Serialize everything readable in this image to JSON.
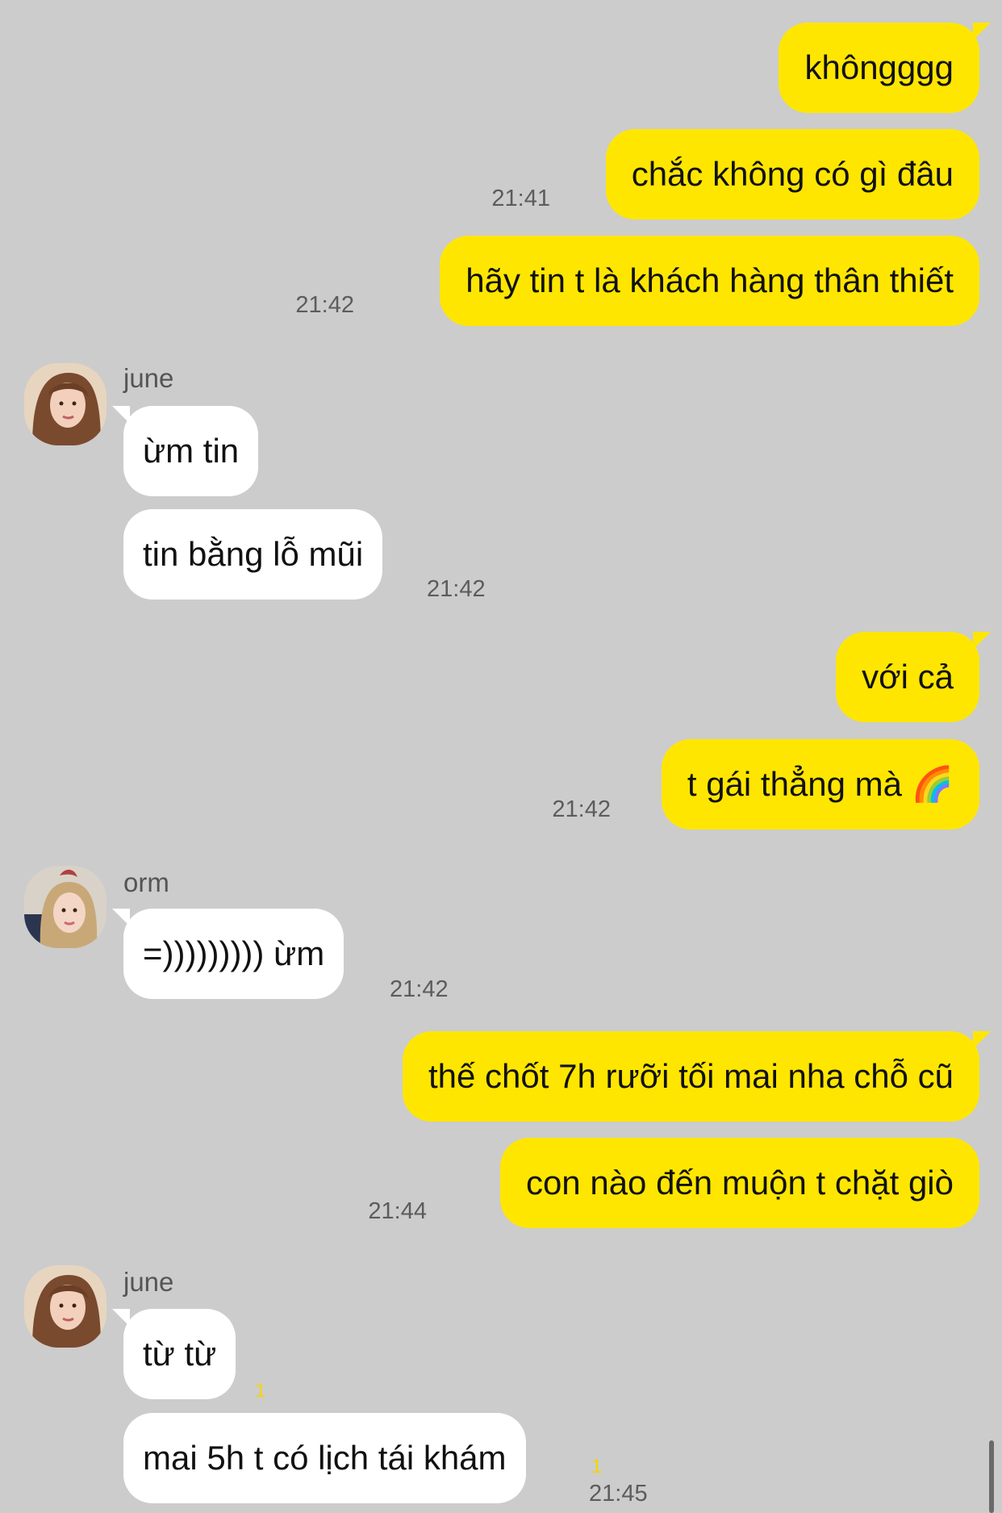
{
  "messages": [
    {
      "text": "khôngggg"
    },
    {
      "text": "chắc không có gì đâu",
      "time": "21:41"
    },
    {
      "text": "hãy tin t là khách hàng thân thiết",
      "time": "21:42"
    },
    {
      "sender": "june",
      "text": "ừm tin"
    },
    {
      "text": "tin bằng lỗ mũi",
      "time": "21:42"
    },
    {
      "text": "với cả"
    },
    {
      "text": "t gái thẳng mà",
      "emoji": "🌈",
      "time": "21:42"
    },
    {
      "sender": "orm",
      "text": "=))))))))) ừm",
      "time": "21:42"
    },
    {
      "text": "thế chốt 7h rưỡi tối mai nha chỗ cũ"
    },
    {
      "text": "con nào đến muộn t chặt giò",
      "time": "21:44"
    },
    {
      "sender": "june",
      "text": "từ từ",
      "unread": "1"
    },
    {
      "text": "mai 5h t có lịch tái khám",
      "unread": "1",
      "time": "21:45"
    }
  ],
  "icons": {
    "avatar_june": "avatar-june",
    "avatar_orm": "avatar-orm"
  },
  "colors": {
    "background": "#cccccc",
    "my_bubble": "#ffe600",
    "their_bubble": "#ffffff",
    "unread": "#f2d600"
  }
}
